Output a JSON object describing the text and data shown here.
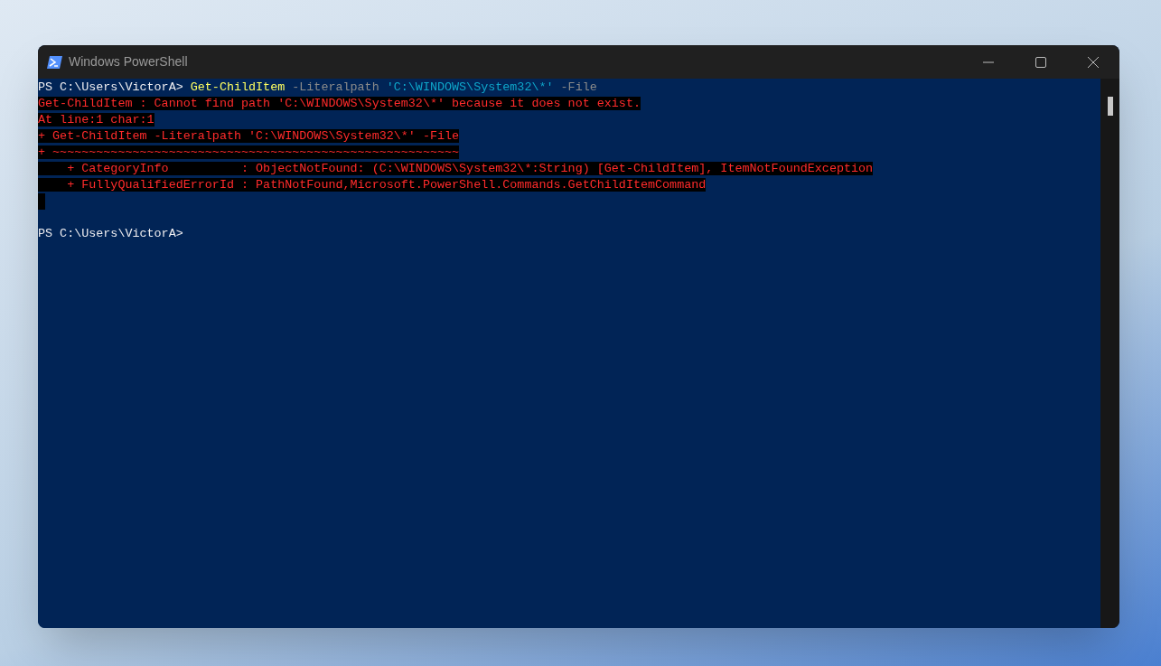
{
  "window": {
    "title": "Windows PowerShell"
  },
  "console": {
    "lines": [
      {
        "kind": "text",
        "segments": [
          {
            "kind": "prompt",
            "text": "PS C:\\Users\\VictorA> "
          },
          {
            "kind": "command",
            "text": "Get-ChildItem"
          },
          {
            "kind": "parameter",
            "text": " -Literalpath "
          },
          {
            "kind": "string",
            "text": "'C:\\WINDOWS\\System32\\*'"
          },
          {
            "kind": "parameter",
            "text": " -File"
          }
        ]
      },
      {
        "kind": "text",
        "segments": [
          {
            "kind": "error",
            "text": "Get-ChildItem : Cannot find path 'C:\\WINDOWS\\System32\\*' because it does not exist."
          }
        ]
      },
      {
        "kind": "text",
        "segments": [
          {
            "kind": "error",
            "text": "At line:1 char:1"
          }
        ]
      },
      {
        "kind": "text",
        "segments": [
          {
            "kind": "error",
            "text": "+ Get-ChildItem -Literalpath 'C:\\WINDOWS\\System32\\*' -File"
          }
        ]
      },
      {
        "kind": "text",
        "segments": [
          {
            "kind": "error",
            "text": "+ ~~~~~~~~~~~~~~~~~~~~~~~~~~~~~~~~~~~~~~~~~~~~~~~~~~~~~~~~"
          }
        ]
      },
      {
        "kind": "text",
        "segments": [
          {
            "kind": "error",
            "text": "    + CategoryInfo          : ObjectNotFound: (C:\\WINDOWS\\System32\\*:String) [Get-ChildItem], ItemNotFoundException"
          }
        ]
      },
      {
        "kind": "text",
        "segments": [
          {
            "kind": "error",
            "text": "    + FullyQualifiedErrorId : PathNotFound,Microsoft.PowerShell.Commands.GetChildItemCommand"
          }
        ]
      },
      {
        "kind": "error-blank"
      },
      {
        "kind": "blank"
      },
      {
        "kind": "text",
        "segments": [
          {
            "kind": "prompt",
            "text": "PS C:\\Users\\VictorA>"
          }
        ]
      }
    ]
  }
}
